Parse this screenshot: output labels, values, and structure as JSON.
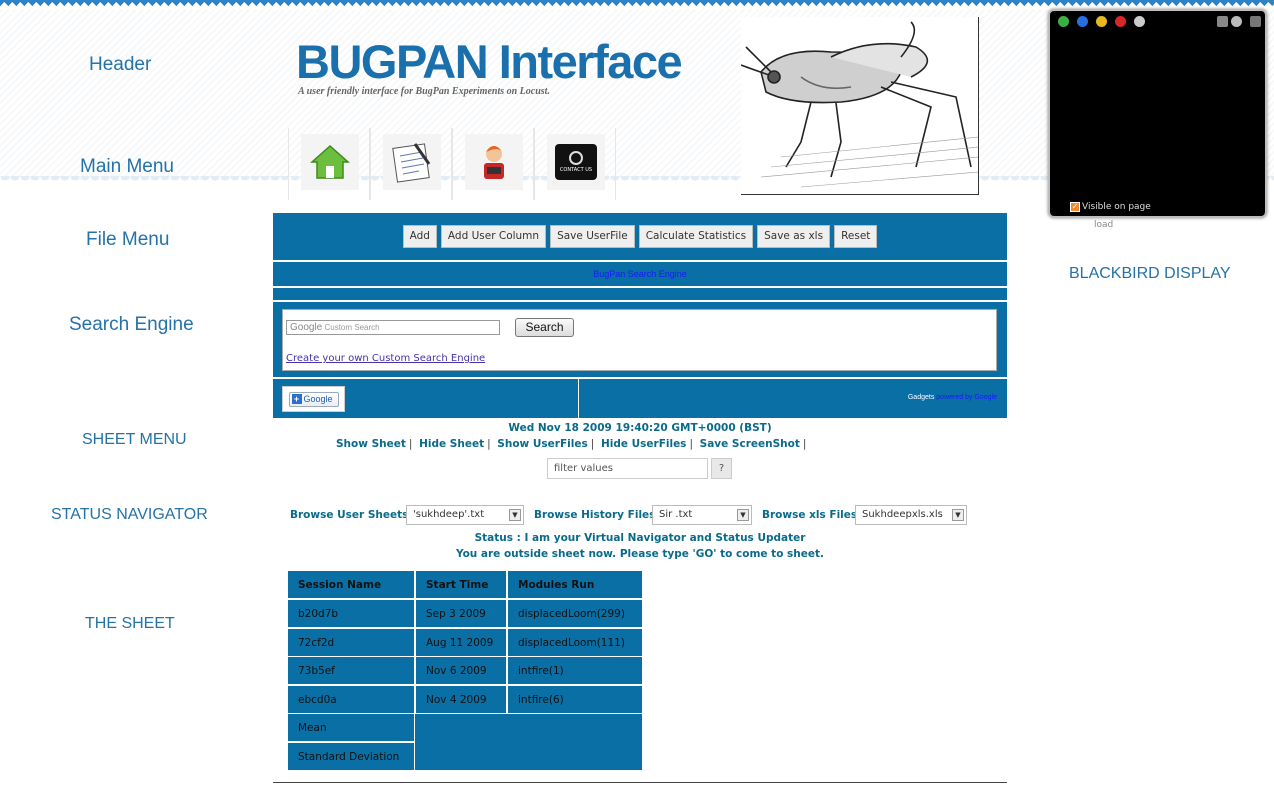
{
  "annotations": {
    "header": "Header",
    "main_menu": "Main Menu",
    "file_menu": "File Menu",
    "search_engine": "Search Engine",
    "sheet_menu": "SHEET MENU",
    "status_navigator": "STATUS NAVIGATOR",
    "the_sheet": "THE SHEET",
    "blackbird": "BLACKBIRD DISPLAY"
  },
  "header": {
    "title": "BUGPAN Interface",
    "subtitle": "A user friendly interface for BugPan Experiments on Locust."
  },
  "main_menu": {
    "items": [
      {
        "icon": "home-icon"
      },
      {
        "icon": "notepad-icon"
      },
      {
        "icon": "user-icon"
      },
      {
        "icon": "contact-us-icon",
        "label": "CONTACT US"
      }
    ]
  },
  "file_menu": {
    "buttons": [
      "Add",
      "Add User Column",
      "Save UserFile",
      "Calculate Statistics",
      "Save as xls",
      "Reset"
    ]
  },
  "search": {
    "title": "BugPan Search Engine",
    "google_word": "Google",
    "placeholder": "Custom Search",
    "button": "Search",
    "create_link": "Create your own Custom Search Engine"
  },
  "gadgets": {
    "add_button": "Google",
    "powered_prefix": "Gadgets",
    "powered_link": "powered by Google"
  },
  "datetime": "Wed Nov 18 2009 19:40:20 GMT+0000 (BST)",
  "sheet_menu": {
    "links": [
      "Show Sheet",
      "Hide Sheet",
      "Show UserFiles",
      "Hide UserFiles",
      "Save ScreenShot"
    ],
    "separator": "|"
  },
  "filter": {
    "value": "filter values",
    "button": "?"
  },
  "status_navigator": {
    "browse_user_label": "Browse User Sheets",
    "browse_user_value": "'sukhdeep'.txt",
    "browse_history_label": "Browse History Files",
    "browse_history_value": "Sir .txt",
    "browse_xls_label": "Browse xls Files",
    "browse_xls_value": "Sukhdeepxls.xls",
    "status_line1": "Status : I am your Virtual Navigator and Status Updater",
    "status_line2": "You are outside sheet now. Please type 'GO' to come to sheet."
  },
  "sheet": {
    "headers": [
      "Session Name",
      "Start Time",
      "Modules Run"
    ],
    "rows": [
      [
        "b20d7b",
        "Sep 3 2009",
        "displacedLoom(299)"
      ],
      [
        "72cf2d",
        "Aug 11 2009",
        "displacedLoom(111)"
      ],
      [
        "73b5ef",
        "Nov 6 2009",
        "intfire(1)"
      ],
      [
        "ebcd0a",
        "Nov 4 2009",
        "intfire(6)"
      ]
    ],
    "mean_label": "Mean",
    "std_label": "Standard Deviation"
  },
  "blackbird": {
    "visible_label": "Visible on page",
    "load_label": "load",
    "colors": {
      "ok": "#3cb043",
      "info": "#2a6fdb",
      "warn": "#e8b820",
      "error": "#d62828",
      "profile": "#cccccc"
    }
  }
}
